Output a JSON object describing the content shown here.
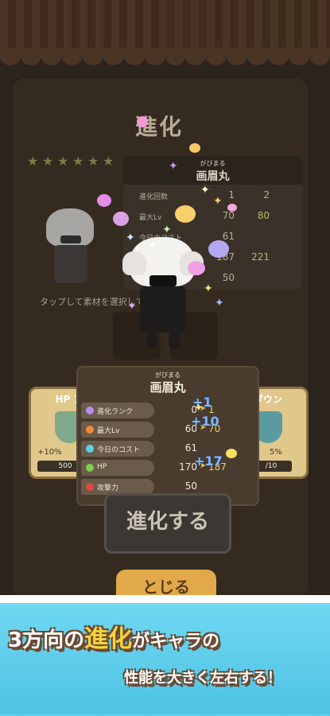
{
  "screen": {
    "title": "進化",
    "tap_hint": "タップして素材を選択してください。",
    "evolve_button": "進化する",
    "close_button": "とじる"
  },
  "back_panel": {
    "ruby": "がびまる",
    "name": "画眉丸",
    "rows": [
      {
        "label": "進化回数",
        "current": "1",
        "next": "2"
      },
      {
        "label": "最大Lv",
        "current": "70",
        "next": "80"
      },
      {
        "label": "今日のコスト",
        "current": "61",
        "next": ""
      },
      {
        "label": "",
        "current": "187",
        "next": "221"
      },
      {
        "label": "",
        "current": "50",
        "next": ""
      }
    ]
  },
  "front_panel": {
    "ruby": "がびまる",
    "name": "画眉丸",
    "rows": [
      {
        "label": "進化ランク",
        "current": "0",
        "next": "1",
        "gain": "+1",
        "icon_color": "#b88cf0"
      },
      {
        "label": "最大Lv",
        "current": "60",
        "next": "70",
        "gain": "+10",
        "icon_color": "#f08a3a"
      },
      {
        "label": "今日のコスト",
        "current": "61",
        "next": "",
        "gain": "",
        "icon_color": "#5ad0e6"
      },
      {
        "label": "HP",
        "current": "170",
        "next": "187",
        "gain": "+17",
        "icon_color": "#7ad14a"
      },
      {
        "label": "攻撃力",
        "current": "50",
        "next": "",
        "gain": "",
        "icon_color": "#e04848"
      }
    ]
  },
  "left_card": {
    "label": "HP ア",
    "pct": "+10%",
    "count": "500"
  },
  "right_card": {
    "label": "ダウン",
    "pct": "5%",
    "count": "/10"
  },
  "banner": {
    "line1_a": "3方向の",
    "line1_b": "進化",
    "line1_c": "がキャラの",
    "line2": "性能を大きく左右する！"
  },
  "colors": {
    "banner_bg": "#5fd0ec",
    "banner_outline": "#6b4a33",
    "close_button": "#e1a94a",
    "gain_text": "#7fb7ff"
  }
}
